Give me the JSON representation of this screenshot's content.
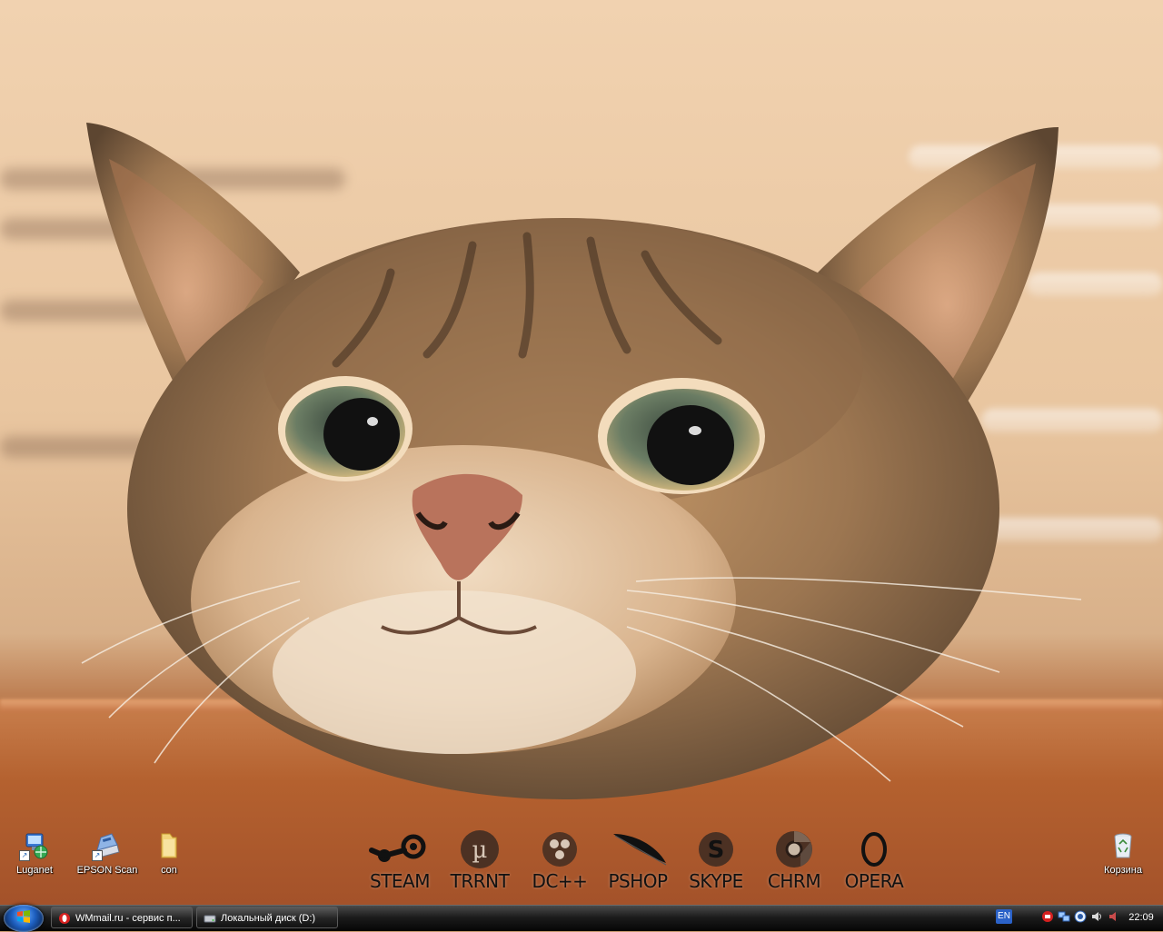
{
  "desktop": {
    "icons_left": [
      {
        "label": "Luganet",
        "icon": "network-computer-icon"
      },
      {
        "label": "EPSON Scan",
        "icon": "scanner-icon"
      },
      {
        "label": "con",
        "icon": "folder-icon"
      }
    ],
    "icons_right": [
      {
        "label": "Корзина",
        "icon": "recycle-bin-icon"
      }
    ]
  },
  "dock": {
    "items": [
      {
        "label": "STEAM",
        "icon": "steam-icon"
      },
      {
        "label": "TRRNT",
        "icon": "utorrent-icon"
      },
      {
        "label": "DC++",
        "icon": "dcpp-icon"
      },
      {
        "label": "PSHOP",
        "icon": "feather-icon"
      },
      {
        "label": "SKYPE",
        "icon": "skype-icon"
      },
      {
        "label": "CHRM",
        "icon": "chrome-icon"
      },
      {
        "label": "OPERA",
        "icon": "opera-icon"
      }
    ]
  },
  "taskbar": {
    "start": {
      "icon": "windows-start-icon"
    },
    "tasks": [
      {
        "label": "WMmail.ru - сервис п...",
        "icon": "opera-icon"
      },
      {
        "label": "Локальный диск (D:)",
        "icon": "drive-icon"
      }
    ],
    "language": "EN",
    "tray_icons": [
      "opera-mail-icon",
      "network-icon",
      "security-icon",
      "volume-icon",
      "speaker-icon"
    ],
    "clock": "22:09"
  },
  "colors": {
    "taskbar_bg": "#1c1c1c",
    "language_badge": "#2b62c8",
    "label_text": "#ffffff",
    "dock_label": "#111111"
  }
}
